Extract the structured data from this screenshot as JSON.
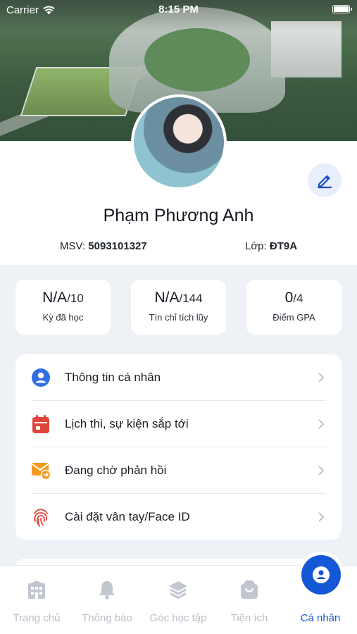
{
  "status": {
    "carrier": "Carrier",
    "time": "8:15 PM"
  },
  "profile": {
    "avatar_caption": "",
    "name": "Phạm Phương Anh",
    "msv_label": "MSV:",
    "msv_value": "5093101327",
    "class_label": "Lớp:",
    "class_value": "ĐT9A",
    "edit_icon": "pencil-icon"
  },
  "stats": [
    {
      "value": "N/A",
      "total": "/10",
      "label": "Kỳ đã học"
    },
    {
      "value": "N/A",
      "total": "/144",
      "label": "Tín chỉ tích lũy"
    },
    {
      "value": "0",
      "total": "/4",
      "label": "Điểm GPA"
    }
  ],
  "menu": [
    {
      "label": "Thông tin cá nhân",
      "icon": "user-circle-icon",
      "color": "#2f6fe0"
    },
    {
      "label": "Lịch thi, sự kiện sắp tới",
      "icon": "calendar-icon",
      "color": "#e0453c"
    },
    {
      "label": "Đang chờ phản hồi",
      "icon": "mail-forward-icon",
      "color": "#f39a1e"
    },
    {
      "label": "Cài đặt vân tay/Face ID",
      "icon": "fingerprint-icon",
      "color": "#e0453c"
    }
  ],
  "tabs": [
    {
      "label": "Trang chủ",
      "icon": "building-icon"
    },
    {
      "label": "Thông báo",
      "icon": "bell-icon"
    },
    {
      "label": "Góc học tập",
      "icon": "layers-icon"
    },
    {
      "label": "Tiện ích",
      "icon": "bag-icon"
    },
    {
      "label": "Cá nhân",
      "icon": "user-icon",
      "active": true
    }
  ],
  "colors": {
    "accent": "#1558d6",
    "inactive": "#b9bec6",
    "background": "#eef1f6"
  }
}
